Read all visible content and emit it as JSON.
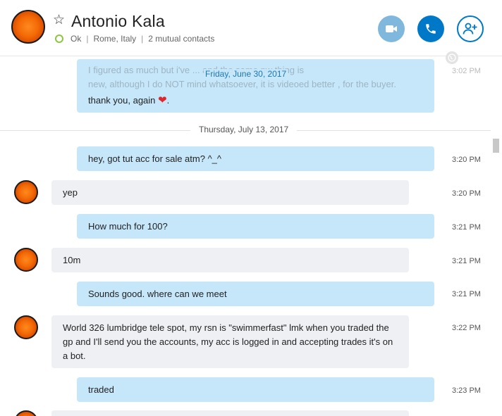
{
  "header": {
    "contact_name": "Antonio Kala",
    "status": "Ok",
    "location": "Rome, Italy",
    "mutual": "2 mutual contacts",
    "separator": "|",
    "video_icon": "video-camera-icon",
    "call_icon": "phone-icon",
    "add_icon": "add-person-icon"
  },
  "colors": {
    "accent": "#0078c8",
    "outgoing_bubble": "#c6e7fa",
    "incoming_bubble": "#eef0f4",
    "status_online": "#8ec63f"
  },
  "top": {
    "ghost_line1": "I figured as much but i've ... and the same pw thing is",
    "ghost_line2": "new, although I do NOT mind whatsoever, it is videoed better , for the buyer.",
    "floating_date": "Friday, June 30, 2017",
    "thanks": "thank you, again",
    "heart": "❤",
    "thanks_end": ".",
    "time_ghost": "3:02 PM"
  },
  "divider": "Thursday, July 13, 2017",
  "messages": [
    {
      "text": "hey, got tut acc for sale atm? ^_^",
      "time": "3:20 PM"
    },
    {
      "text": "yep",
      "time": "3:20 PM"
    },
    {
      "text": "How much for 100?",
      "time": "3:21 PM"
    },
    {
      "text": "10m",
      "time": "3:21 PM"
    },
    {
      "text": "Sounds good.  where can we meet",
      "time": "3:21 PM"
    },
    {
      "text": "World 326 lumbridge tele spot, my rsn is \"swimmerfast\" lmk when you traded the gp and I'll send you the accounts, my acc is logged in and accepting trades it's on a bot.",
      "time": "3:22 PM"
    },
    {
      "text": "traded",
      "time": "3:23 PM"
    }
  ]
}
